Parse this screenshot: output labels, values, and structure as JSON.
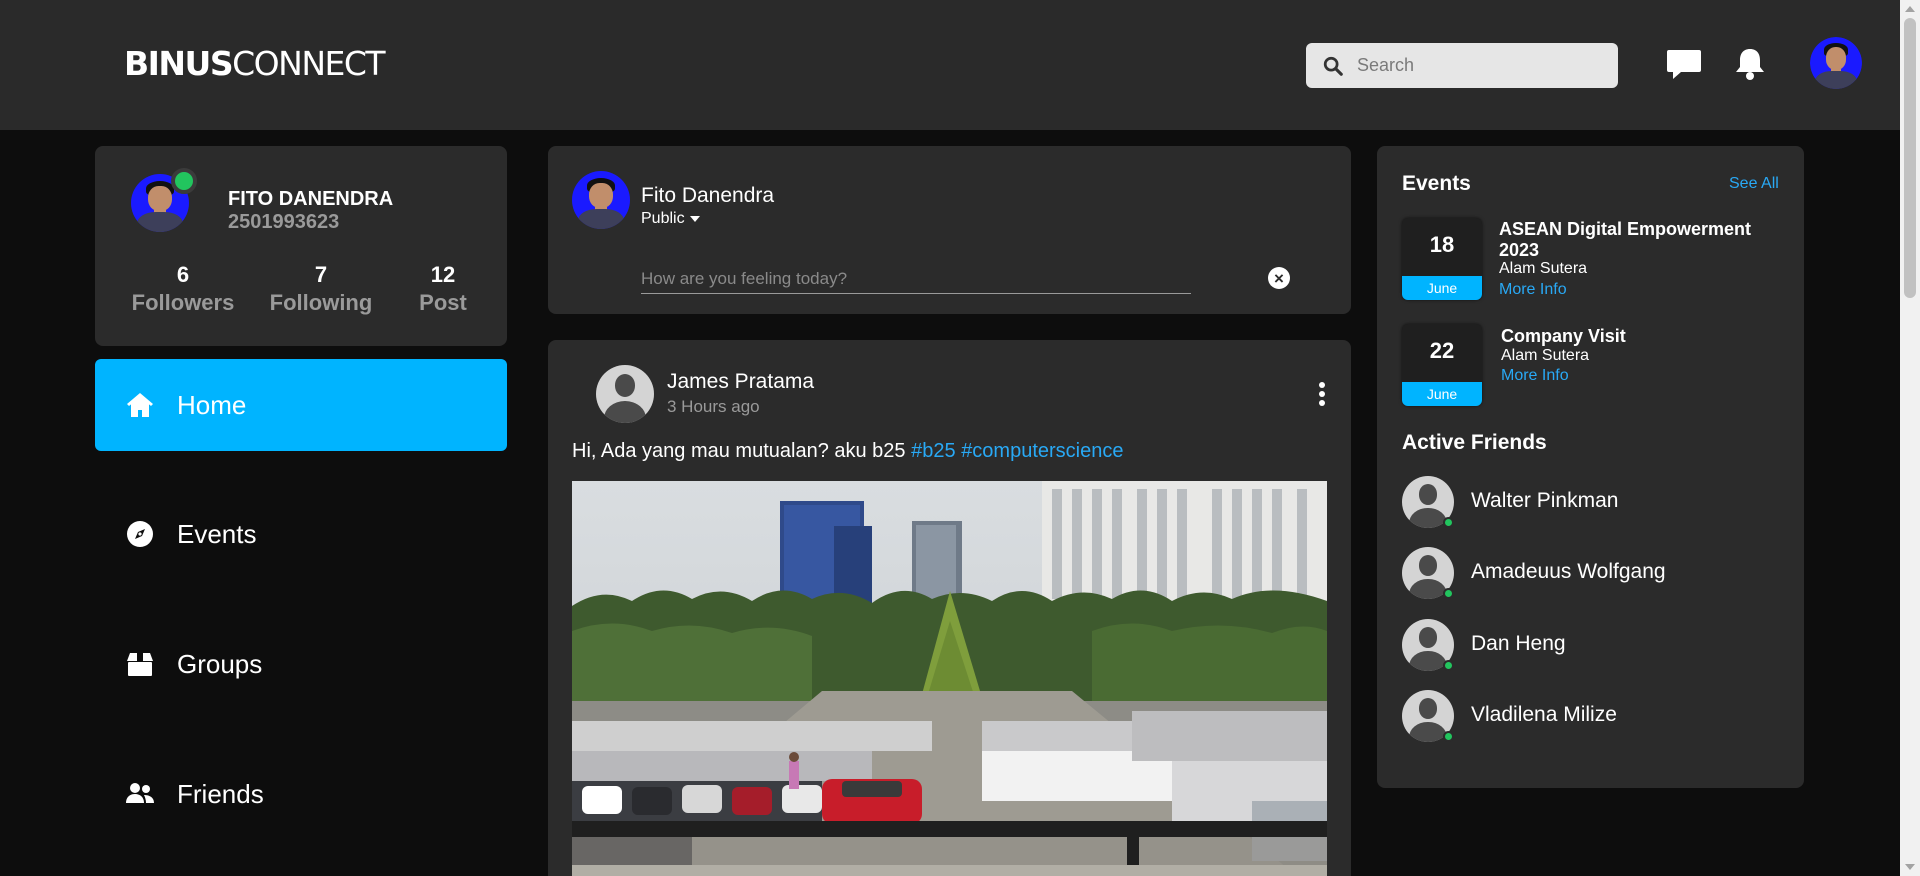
{
  "header": {
    "logo_bold": "BINUS",
    "logo_regular": "CONNECT",
    "search_placeholder": "Search"
  },
  "profile": {
    "name": "FITO DANENDRA",
    "id": "2501993623",
    "stats": [
      {
        "value": "6",
        "label": "Followers"
      },
      {
        "value": "7",
        "label": "Following"
      },
      {
        "value": "12",
        "label": "Post"
      }
    ]
  },
  "nav": [
    {
      "label": "Home",
      "icon": "home-icon",
      "active": true
    },
    {
      "label": "Events",
      "icon": "compass-icon"
    },
    {
      "label": "Groups",
      "icon": "box-icon"
    },
    {
      "label": "Friends",
      "icon": "users-icon"
    }
  ],
  "composer": {
    "name": "Fito Danendra",
    "visibility": "Public",
    "placeholder": "How are you feeling today?",
    "close_symbol": "×"
  },
  "post": {
    "author": "James Pratama",
    "time": "3 Hours ago",
    "text": "Hi, Ada yang mau mutualan? aku b25",
    "tags": [
      "#b25",
      "#computerscience"
    ]
  },
  "events": {
    "title": "Events",
    "see_all": "See All",
    "items": [
      {
        "day": "18",
        "month": "June",
        "title": "ASEAN Digital Empowerment 2023",
        "place": "Alam Sutera",
        "link": "More Info"
      },
      {
        "day": "22",
        "month": "June",
        "title": "Company Visit",
        "place": "Alam Sutera",
        "link": "More Info"
      }
    ]
  },
  "active_friends": {
    "title": "Active Friends",
    "items": [
      {
        "name": "Walter Pinkman"
      },
      {
        "name": "Amadeuus Wolfgang"
      },
      {
        "name": "Dan Heng"
      },
      {
        "name": "Vladilena Milize"
      }
    ]
  },
  "colors": {
    "accent": "#00b4ff",
    "link": "#29a9f5",
    "online": "#22c55e",
    "card": "#2b2b2b",
    "header": "#2a2a2a"
  }
}
